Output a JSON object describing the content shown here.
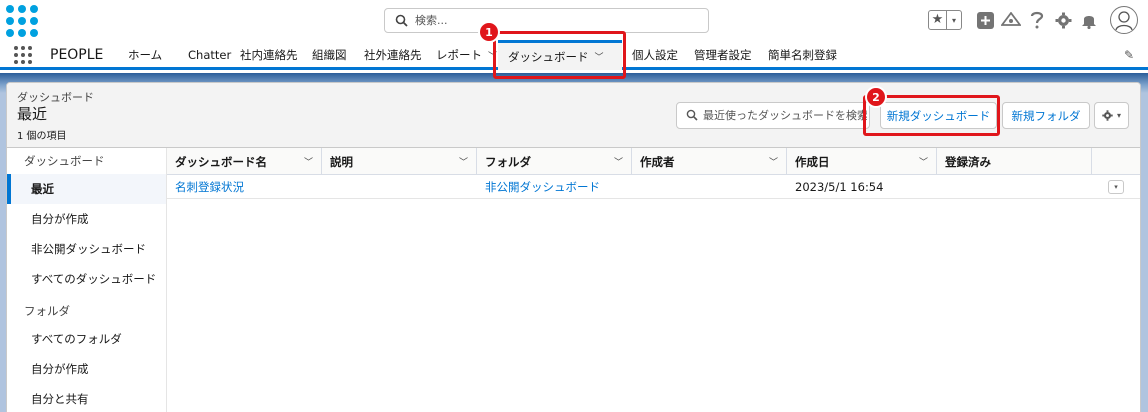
{
  "header": {
    "search_placeholder": "検索...",
    "star_icon": "★",
    "dropdown_icon": "▾"
  },
  "nav": {
    "app_name": "PEOPLE",
    "items": [
      {
        "label": "ホーム",
        "dropdown": false
      },
      {
        "label": "Chatter",
        "dropdown": false
      },
      {
        "label": "社内連絡先",
        "dropdown": false
      },
      {
        "label": "組織図",
        "dropdown": false
      },
      {
        "label": "社外連絡先",
        "dropdown": false
      },
      {
        "label": "レポート",
        "dropdown": true
      },
      {
        "label": "ダッシュボード",
        "dropdown": true,
        "active": true
      },
      {
        "label": "個人設定",
        "dropdown": false
      },
      {
        "label": "管理者設定",
        "dropdown": false
      },
      {
        "label": "簡単名刺登録",
        "dropdown": false
      }
    ]
  },
  "list_header": {
    "breadcrumb": "ダッシュボード",
    "title": "最近",
    "item_count": "1 個の項目",
    "search_placeholder": "最近使ったダッシュボードを検索",
    "new_dashboard_button": "新規ダッシュボード",
    "new_folder_button": "新規フォルダ"
  },
  "sidebar": {
    "sections": [
      {
        "title": "ダッシュボード",
        "items": [
          {
            "label": "最近",
            "active": true
          },
          {
            "label": "自分が作成"
          },
          {
            "label": "非公開ダッシュボード"
          },
          {
            "label": "すべてのダッシュボード"
          }
        ]
      },
      {
        "title": "フォルダ",
        "items": [
          {
            "label": "すべてのフォルダ"
          },
          {
            "label": "自分が作成"
          },
          {
            "label": "自分と共有"
          }
        ]
      }
    ]
  },
  "table": {
    "columns": [
      "ダッシュボード名",
      "説明",
      "フォルダ",
      "作成者",
      "作成日",
      "登録済み"
    ],
    "rows": [
      {
        "name": "名刺登録状況",
        "description": "",
        "folder": "非公開ダッシュボード",
        "created_by": "",
        "created_date": "2023/5/1 16:54",
        "subscribed": ""
      }
    ]
  },
  "annotations": {
    "badge_1": "1",
    "badge_2": "2",
    "color": "#e0161b"
  },
  "colors": {
    "brand": "#0176d3",
    "logo": "#00a1e0"
  }
}
